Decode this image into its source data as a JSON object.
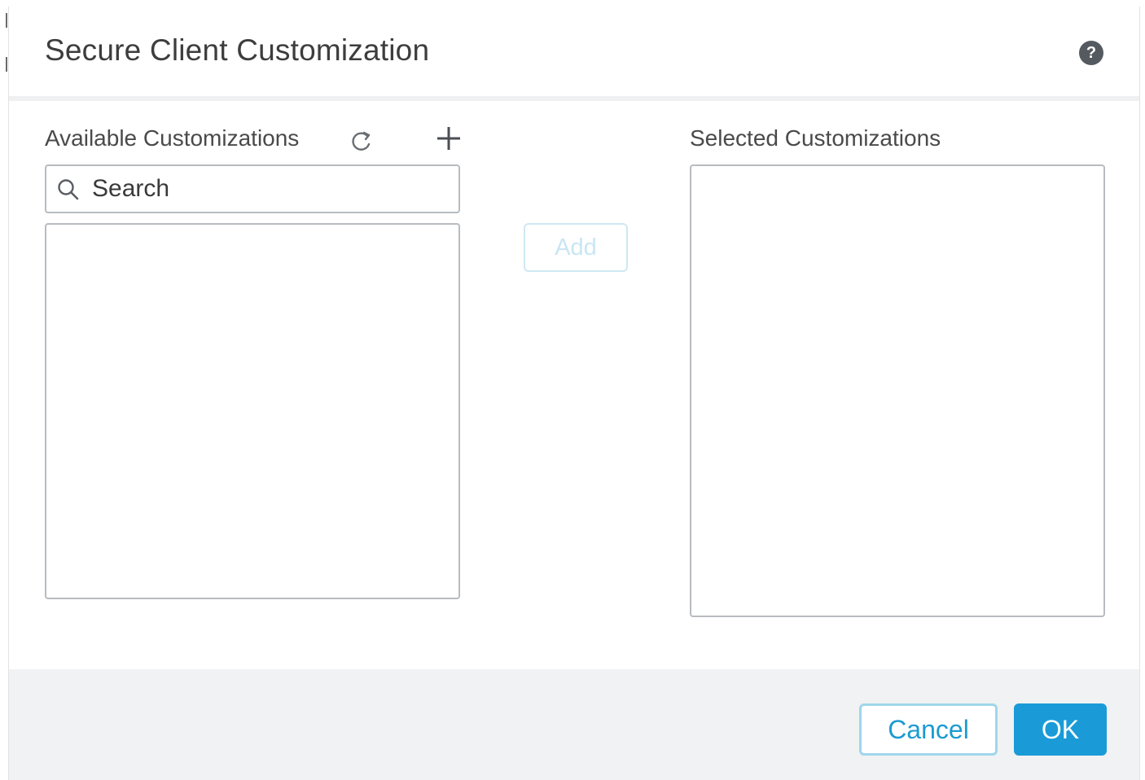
{
  "dialog": {
    "title": "Secure Client Customization",
    "help_icon": "question-mark-icon",
    "help_glyph": "?"
  },
  "available": {
    "label": "Available Customizations",
    "refresh_icon": "refresh-icon",
    "add_new_icon": "plus-icon",
    "search": {
      "placeholder": "Search",
      "value": ""
    },
    "items": []
  },
  "add_button": {
    "label": "Add",
    "enabled": false
  },
  "selected": {
    "label": "Selected Customizations",
    "items": []
  },
  "footer": {
    "cancel_label": "Cancel",
    "ok_label": "OK"
  },
  "colors": {
    "accent": "#1a9bd7",
    "disabled_accent": "#c9e6f3",
    "footer_bg": "#f1f2f3"
  }
}
